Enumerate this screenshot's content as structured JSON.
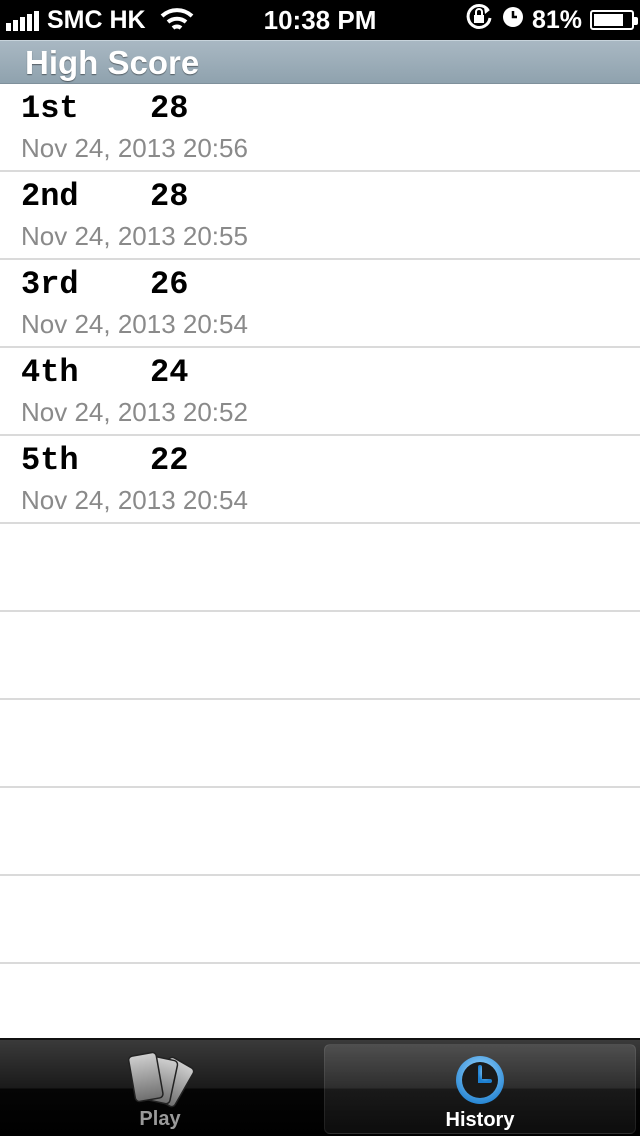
{
  "status_bar": {
    "carrier": "SMC HK",
    "time": "10:38 PM",
    "battery_percent": "81%",
    "battery_level": 0.81
  },
  "section": {
    "title": "High Score"
  },
  "scores": [
    {
      "rank": "1st",
      "score": "28",
      "date": "Nov 24, 2013 20:56"
    },
    {
      "rank": "2nd",
      "score": "28",
      "date": "Nov 24, 2013 20:55"
    },
    {
      "rank": "3rd",
      "score": "26",
      "date": "Nov 24, 2013 20:54"
    },
    {
      "rank": "4th",
      "score": "24",
      "date": "Nov 24, 2013 20:52"
    },
    {
      "rank": "5th",
      "score": "22",
      "date": "Nov 24, 2013 20:54"
    }
  ],
  "tab_bar": {
    "tabs": [
      {
        "label": "Play",
        "icon": "cards-icon",
        "selected": false
      },
      {
        "label": "History",
        "icon": "clock-icon",
        "selected": true
      }
    ]
  },
  "colors": {
    "header_top": "#a9b8c3",
    "header_bottom": "#8fa2ae",
    "date_text": "#8a8a8a",
    "separator": "#dadada",
    "history_accent": "#2f9be8"
  }
}
